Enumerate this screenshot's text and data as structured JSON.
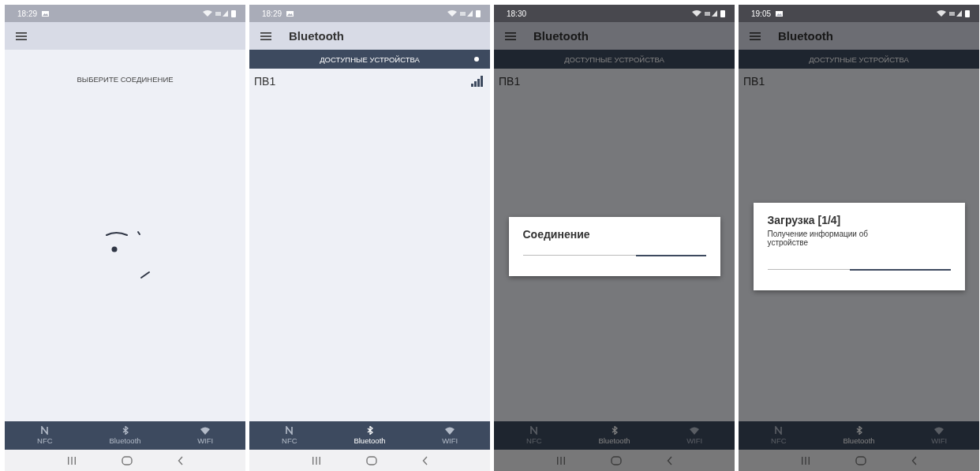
{
  "screens": [
    {
      "status_bar": {
        "time": "18:29",
        "image_notification": true
      },
      "content": {
        "kind": "prompt",
        "message": "ВЫБЕРИТЕ СОЕДИНЕНИЕ"
      },
      "bottom_nav": [
        {
          "label": "NFC",
          "selected": false
        },
        {
          "label": "Bluetooth",
          "selected": false
        },
        {
          "label": "WIFI",
          "selected": false
        }
      ],
      "dimmed": false
    },
    {
      "status_bar": {
        "time": "18:29",
        "image_notification": true
      },
      "app_bar": {
        "title": "Bluetooth"
      },
      "content": {
        "kind": "devices",
        "header": "ДОСТУПНЫЕ УСТРОЙСТВА",
        "scanning": true,
        "devices": [
          {
            "name": "ПВ1",
            "signal": true
          }
        ]
      },
      "bottom_nav": [
        {
          "label": "NFC",
          "selected": false
        },
        {
          "label": "Bluetooth",
          "selected": true
        },
        {
          "label": "WIFI",
          "selected": false
        }
      ],
      "dimmed": false
    },
    {
      "status_bar": {
        "time": "18:30",
        "image_notification": false
      },
      "app_bar": {
        "title": "Bluetooth"
      },
      "content": {
        "kind": "devices",
        "header": "ДОСТУПНЫЕ УСТРОЙСТВА",
        "scanning": false,
        "devices": [
          {
            "name": "ПВ1",
            "signal": false
          }
        ]
      },
      "bottom_nav": [
        {
          "label": "NFC",
          "selected": false
        },
        {
          "label": "Bluetooth",
          "selected": true
        },
        {
          "label": "WIFI",
          "selected": false
        }
      ],
      "dimmed": true,
      "dialog": {
        "title": "Соединение",
        "level": 0.38
      }
    },
    {
      "status_bar": {
        "time": "19:05",
        "image_notification": true
      },
      "app_bar": {
        "title": "Bluetooth"
      },
      "content": {
        "kind": "devices",
        "header": "ДОСТУПНЫЕ УСТРОЙСТВА",
        "scanning": false,
        "devices": [
          {
            "name": "ПВ1",
            "signal": false
          }
        ]
      },
      "bottom_nav": [
        {
          "label": "NFC",
          "selected": false
        },
        {
          "label": "Bluetooth",
          "selected": true
        },
        {
          "label": "WIFI",
          "selected": false
        }
      ],
      "dimmed": true,
      "dialog": {
        "title": "Загрузка [1/4]",
        "message": "Получение информации об устройстве",
        "level": 0.55
      }
    }
  ]
}
